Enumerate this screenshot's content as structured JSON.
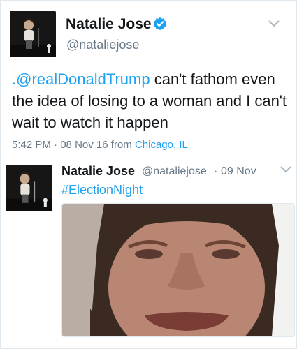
{
  "tweet": {
    "name": "Natalie Jose",
    "handle": "@nataliejose",
    "mention": ".@realDonaldTrump",
    "text": " can't fathom even the idea of losing to a woman and I can't wait to watch it happen",
    "time": "5:42 PM",
    "sep": "·",
    "date": "08 Nov 16",
    "from_label": "from",
    "location": "Chicago, IL"
  },
  "reply": {
    "name": "Natalie Jose",
    "handle": "@nataliejose",
    "sep": "·",
    "date": "09 Nov",
    "hashtag": "#ElectionNight"
  },
  "icons": {
    "verified": "verified-badge-icon",
    "menu": "chevron-down-icon"
  },
  "colors": {
    "accent": "#1da1f2",
    "muted": "#657786",
    "text": "#14171a"
  }
}
